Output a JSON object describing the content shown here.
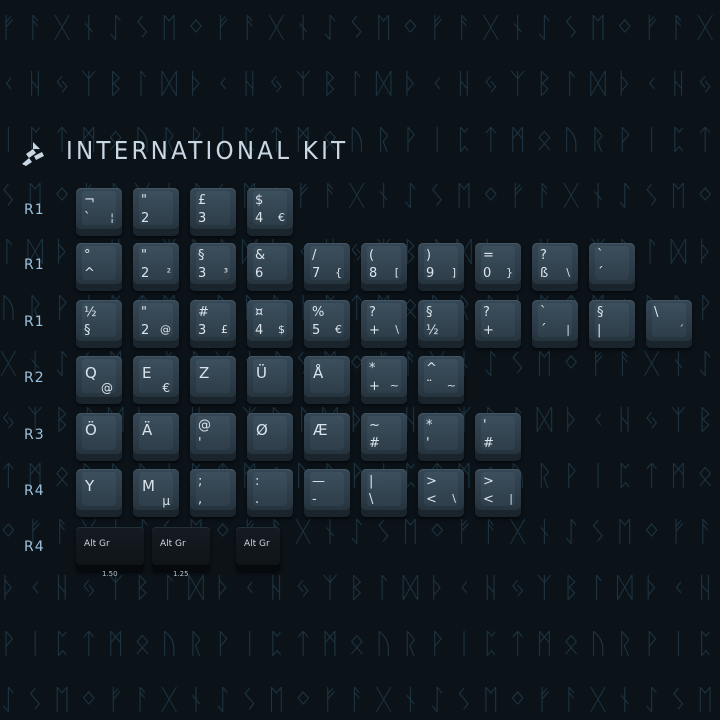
{
  "title": "INTERNATIONAL KIT",
  "background_runes": "ᚠᚢᚦᚨᚱᚲᚷᚹᚺᚾᛁᛃᛇᛈᛉᛊᛏᛒᛖᛗᛚᛜᛟᛞ",
  "colors": {
    "background": "#0b1218",
    "rune": "#1d3340",
    "title": "#c9d7e3",
    "row_label": "#9cc1dd",
    "keycap": "#2f3f4b",
    "legend": "#dbe4eb",
    "alt_keycap": "#12181d"
  },
  "rows": [
    {
      "label": "R1",
      "keys": [
        {
          "tl": "¬",
          "bl": "`",
          "br": "¦"
        },
        {
          "tl": "\"",
          "bl": "2"
        },
        {
          "tl": "£",
          "bl": "3"
        },
        {
          "tl": "$",
          "bl": "4",
          "br": "€"
        }
      ]
    },
    {
      "label": "R1",
      "keys": [
        {
          "tl": "°",
          "bl": "^"
        },
        {
          "tl": "\"",
          "bl": "2",
          "br": "²"
        },
        {
          "tl": "§",
          "bl": "3",
          "br": "³"
        },
        {
          "tl": "&",
          "bl": "6"
        },
        {
          "tl": "/",
          "bl": "7",
          "br": "{"
        },
        {
          "tl": "(",
          "bl": "8",
          "br": "["
        },
        {
          "tl": ")",
          "bl": "9",
          "br": "]"
        },
        {
          "tl": "=",
          "bl": "0",
          "br": "}"
        },
        {
          "tl": "?",
          "bl": "ß",
          "br": "\\"
        },
        {
          "tl": "`",
          "bl": "´"
        }
      ]
    },
    {
      "label": "R1",
      "keys": [
        {
          "tl": "½",
          "bl": "§"
        },
        {
          "tl": "\"",
          "bl": "2",
          "br": "@"
        },
        {
          "tl": "#",
          "bl": "3",
          "br": "£"
        },
        {
          "tl": "¤",
          "bl": "4",
          "br": "$"
        },
        {
          "tl": "%",
          "bl": "5",
          "br": "€"
        },
        {
          "tl": "?",
          "bl": "+",
          "br": "\\"
        },
        {
          "tl": "§",
          "bl": "½"
        },
        {
          "tl": "?",
          "bl": "+"
        },
        {
          "tl": "`",
          "bl": "´",
          "br": "|"
        },
        {
          "tl": "§",
          "bl": "|"
        },
        {
          "tl": "\\",
          "br": "´"
        }
      ]
    },
    {
      "label": "R2",
      "keys": [
        {
          "big": "Q",
          "brb": "@"
        },
        {
          "big": "E",
          "brb": "€"
        },
        {
          "big": "Z"
        },
        {
          "big": "Ü"
        },
        {
          "big": "Å"
        },
        {
          "tl": "*",
          "bl": "+",
          "br": "~"
        },
        {
          "tl": "^",
          "bl": "¨",
          "br": "~"
        }
      ]
    },
    {
      "label": "R3",
      "keys": [
        {
          "big": "Ö"
        },
        {
          "big": "Ä"
        },
        {
          "tl": "@",
          "bl": "'"
        },
        {
          "big": "Ø"
        },
        {
          "big": "Æ"
        },
        {
          "tl": "~",
          "bl": "#"
        },
        {
          "tl": "*",
          "bl": "'"
        },
        {
          "tl": "'",
          "bl": "#"
        }
      ]
    },
    {
      "label": "R4",
      "keys": [
        {
          "big": "Y"
        },
        {
          "big": "M",
          "brb": "µ"
        },
        {
          "tl": ";",
          "bl": ","
        },
        {
          "tl": ":",
          "bl": "."
        },
        {
          "tl": "—",
          "bl": "-"
        },
        {
          "tl": "|",
          "bl": "\\"
        },
        {
          "tl": ">",
          "bl": "<",
          "br": "\\"
        },
        {
          "tl": ">",
          "bl": "<",
          "br": "|"
        }
      ]
    },
    {
      "label": "R4",
      "alt_keys": [
        {
          "label": "Alt Gr",
          "size": "1.50"
        },
        {
          "label": "Alt Gr",
          "size": "1.25"
        },
        {
          "label": "Alt Gr",
          "size": ""
        }
      ]
    }
  ]
}
